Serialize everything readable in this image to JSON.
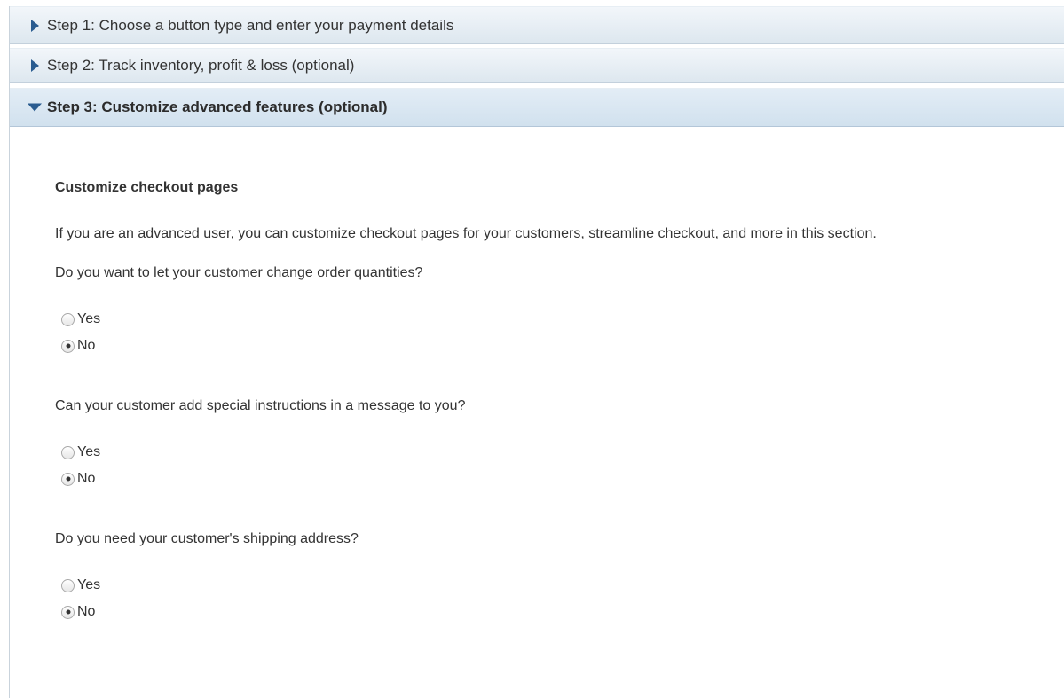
{
  "steps": [
    {
      "label": "Step 1: Choose a button type and enter your payment details",
      "state": "collapsed",
      "icon": "triangle-right-icon"
    },
    {
      "label": "Step 2: Track inventory, profit & loss (optional)",
      "state": "collapsed",
      "icon": "triangle-right-icon"
    },
    {
      "label": "Step 3: Customize advanced features (optional)",
      "state": "expanded",
      "icon": "triangle-down-icon"
    }
  ],
  "section": {
    "title": "Customize checkout pages",
    "intro": "If you are an advanced user, you can customize checkout pages for your customers, streamline checkout, and more in this section."
  },
  "questions": [
    {
      "text": "Do you want to let your customer change order quantities?",
      "options": [
        {
          "label": "Yes",
          "selected": false
        },
        {
          "label": "No",
          "selected": true
        }
      ]
    },
    {
      "text": "Can your customer add special instructions in a message to you?",
      "options": [
        {
          "label": "Yes",
          "selected": false
        },
        {
          "label": "No",
          "selected": true
        }
      ]
    },
    {
      "text": "Do you need your customer's shipping address?",
      "options": [
        {
          "label": "Yes",
          "selected": false
        },
        {
          "label": "No",
          "selected": true
        }
      ]
    }
  ],
  "colors": {
    "accent": "#2a5c90",
    "header_bg": "#dde7ef",
    "text": "#333333"
  }
}
